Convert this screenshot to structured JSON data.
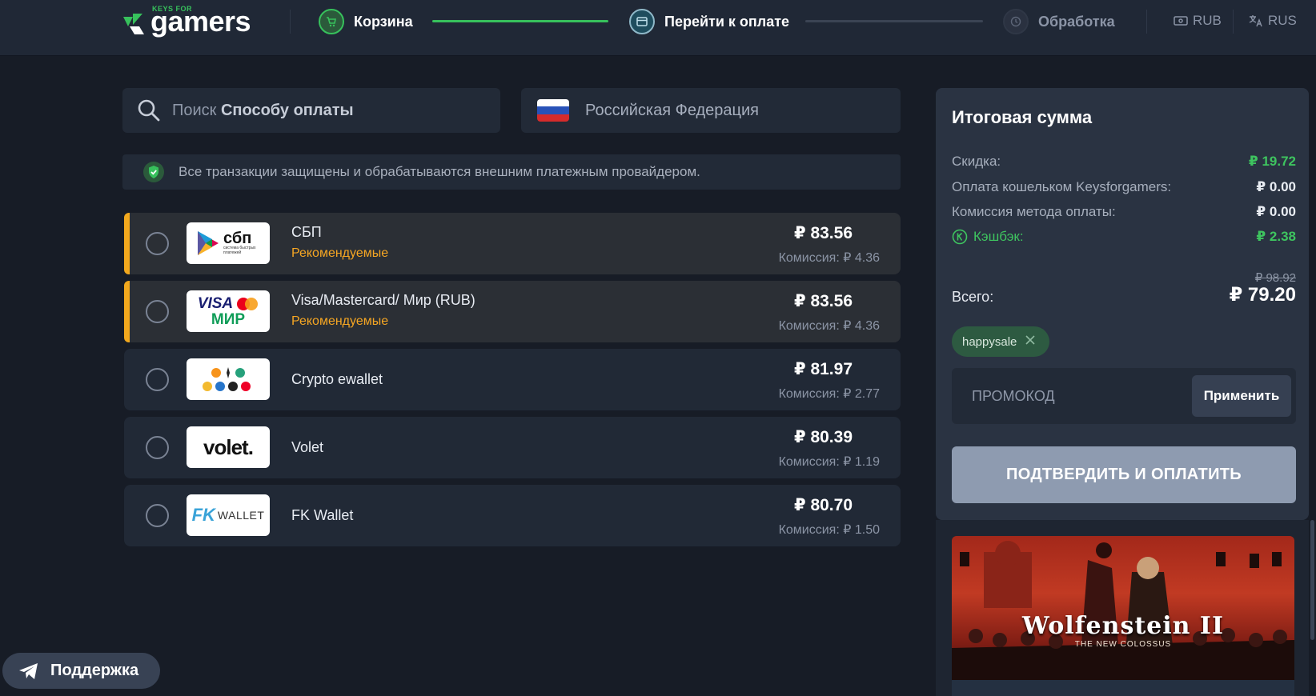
{
  "header": {
    "logo_small": "KEYS FOR",
    "logo_big": "gamers",
    "steps": [
      {
        "label": "Корзина"
      },
      {
        "label": "Перейти к оплате"
      },
      {
        "label": "Обработка"
      }
    ],
    "currency": "RUB",
    "language": "RUS"
  },
  "search": {
    "placeholder_prefix": "Поиск ",
    "placeholder_bold": "Способу оплаты"
  },
  "country": {
    "name": "Российская Федерация"
  },
  "notice": {
    "text": "Все транзакции защищены и обрабатываются внешним платежным провайдером."
  },
  "methods": [
    {
      "name": "СБП",
      "recommended": "Рекомендуемые",
      "price": "₽ 83.56",
      "fee": "Комиссия: ₽ 4.36",
      "logo_text": "сбп",
      "logo_sub": "система быстрых платежей"
    },
    {
      "name": "Visa/Mastercard/ Мир (RUB)",
      "recommended": "Рекомендуемые",
      "price": "₽ 83.56",
      "fee": "Комиссия: ₽ 4.36",
      "logo_text": "VISA",
      "logo_sub": "МИР"
    },
    {
      "name": "Crypto ewallet",
      "recommended": "",
      "price": "₽ 81.97",
      "fee": "Комиссия: ₽ 2.77",
      "logo_text": "",
      "logo_sub": ""
    },
    {
      "name": "Volet",
      "recommended": "",
      "price": "₽ 80.39",
      "fee": "Комиссия: ₽ 1.19",
      "logo_text": "volet.",
      "logo_sub": ""
    },
    {
      "name": "FK Wallet",
      "recommended": "",
      "price": "₽ 80.70",
      "fee": "Комиссия: ₽ 1.50",
      "logo_text": "FK",
      "logo_sub": "WALLET"
    }
  ],
  "summary": {
    "title": "Итоговая сумма",
    "rows": [
      {
        "label": "Скидка:",
        "value": "₽ 19.72"
      },
      {
        "label": "Оплата кошельком Keysforgamers:",
        "value": "₽ 0.00"
      },
      {
        "label": "Комиссия метода оплаты:",
        "value": "₽ 0.00"
      },
      {
        "label": "Кэшбэк:",
        "value": "₽ 2.38"
      }
    ],
    "old_total": "₽ 98.92",
    "total_label": "Всего:",
    "total_value": "₽ 79.20",
    "promo_chip": "happysale",
    "promo_placeholder": "ПРОМОКОД",
    "apply_label": "Применить",
    "confirm_label": "ПОДТВЕРДИТЬ И ОПЛАТИТЬ"
  },
  "game": {
    "title": "Wolfenstein II",
    "subtitle": "THE NEW COLOSSUS"
  },
  "support": {
    "label": "Поддержка"
  },
  "colors": {
    "accent_green": "#3ec45f",
    "recommended_orange": "#f5a623",
    "confirm_button": "#8e9bb0"
  }
}
